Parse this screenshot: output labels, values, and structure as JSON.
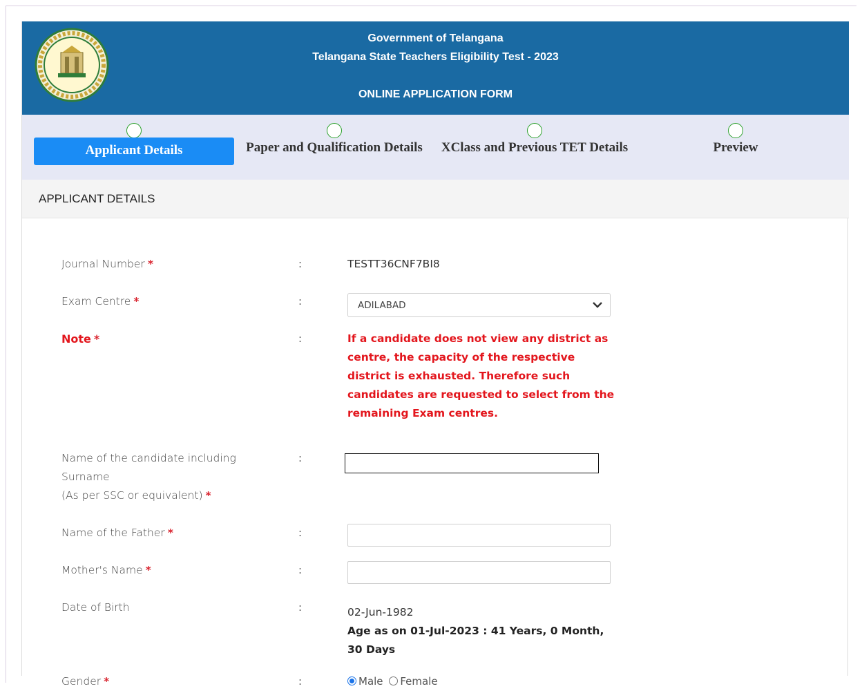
{
  "header": {
    "line1": "Government of Telangana",
    "line2": "Telangana State Teachers Eligibility Test - 2023",
    "line3": "ONLINE APPLICATION FORM",
    "logo_icon": "telangana-emblem-icon",
    "bg_color": "#1a6aa3"
  },
  "steps": [
    {
      "label": "Applicant Details",
      "active": true
    },
    {
      "label": "Paper and Qualification Details",
      "active": false
    },
    {
      "label": "XClass and Previous TET Details",
      "active": false
    },
    {
      "label": "Preview",
      "active": false
    }
  ],
  "section": {
    "title": "APPLICANT DETAILS"
  },
  "form": {
    "journal": {
      "label": "Journal Number",
      "value": "TESTT36CNF7BI8"
    },
    "exam_centre": {
      "label": "Exam Centre",
      "selected": "ADILABAD"
    },
    "note": {
      "label": "Note",
      "text": "If a candidate does not view any district as centre, the capacity of the respective district is exhausted. Therefore such candidates are requested to select from the remaining Exam centres."
    },
    "candidate_name": {
      "label_line1": "Name of the candidate including",
      "label_line2": "Surname",
      "label_line3": "(As per SSC or equivalent)",
      "value": ""
    },
    "father_name": {
      "label": "Name of the Father",
      "value": ""
    },
    "mother_name": {
      "label": "Mother's Name",
      "value": ""
    },
    "dob": {
      "label": "Date of Birth",
      "value": "02-Jun-1982",
      "age_line1": "Age as on 01-Jul-2023 : 41 Years, 0 Month,",
      "age_line2": "30 Days"
    },
    "gender": {
      "label": "Gender",
      "options": [
        "Male",
        "Female"
      ],
      "selected": "Male"
    },
    "colon": ":",
    "required": "*"
  },
  "colors": {
    "accent": "#1a8cf5",
    "required": "#d9232e",
    "note": "#e3161d",
    "step_circle": "#2aa02a"
  }
}
